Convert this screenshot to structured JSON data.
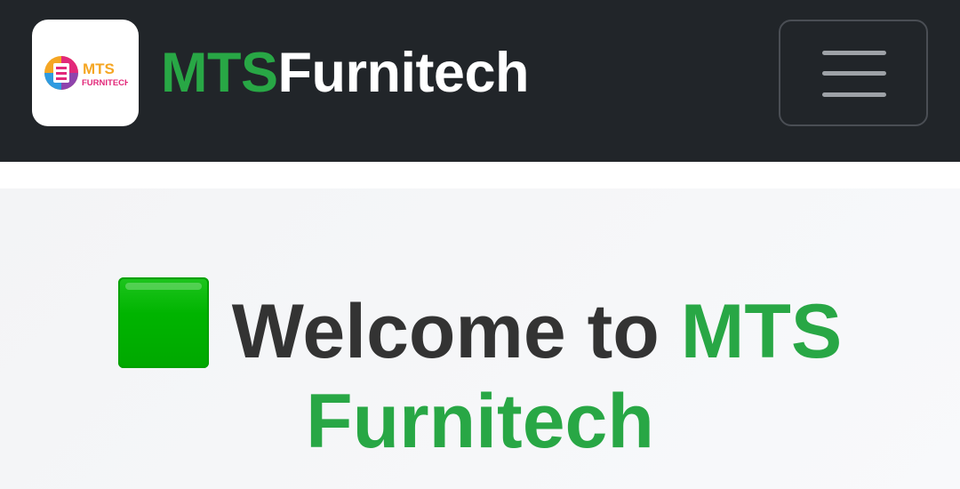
{
  "navbar": {
    "logo": {
      "line1": "MTS",
      "line2": "FURNITECH",
      "colors": [
        "#f5a623",
        "#e2297a",
        "#2f9be0",
        "#37b34a",
        "#8e44ad"
      ]
    },
    "brand": {
      "accent": "MTS",
      "rest": "Furnitech",
      "accent_color": "#28a745"
    },
    "menu_icon": "hamburger-icon"
  },
  "hero": {
    "emoji_icon": "green-square-icon",
    "title_prefix": "Welcome to ",
    "title_accent_1": "MTS",
    "title_accent_2": "Furnitech",
    "accent_color": "#28a745",
    "text_color": "#333333"
  }
}
